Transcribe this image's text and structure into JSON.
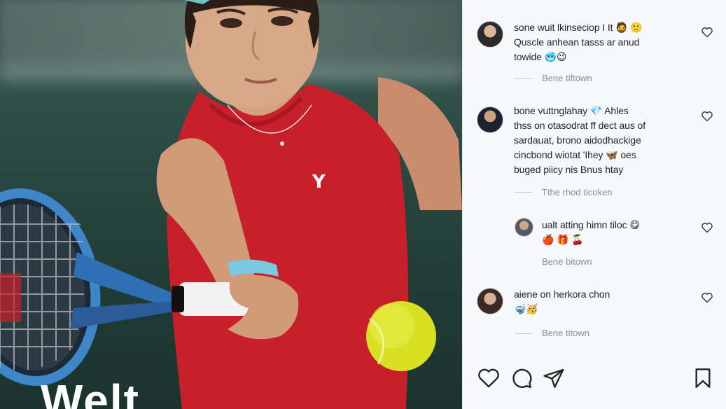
{
  "photo": {
    "overlay_text": "Welt",
    "brand_colors": {
      "jersey": "#c8202a",
      "court": "#203c35",
      "ball": "#d9e021"
    }
  },
  "comments": [
    {
      "text": "sone wuit lkinseciop I It 🧔 🙂\nQuscle anhean tasss ar anud\ntowide 🥶😉",
      "reply_label": "Bene tiftown",
      "avatar": "avatar-woman"
    },
    {
      "text": "bone vuttnglahay 💎 Ahles\nthss on otasodrat ff dect aus of\nsardauat, brono aidodhackige\ncincbond wiotat 'Ihey 🦋 oes\nbuged piicy nis Bnus htay",
      "reply_label": "Tthe rhod ticoken",
      "avatar": "avatar-man"
    },
    {
      "text": "ualt atting himn tiloc 😋\n🍎 🎁 🍒",
      "reply_label": "Bene bitown",
      "avatar": "avatar-man-reply"
    },
    {
      "text": "aiene on herkora chon\n🤿🥳",
      "reply_label": "Bene titown",
      "avatar": "avatar-woman-2"
    }
  ],
  "icons": {
    "like": "heart-icon",
    "comment": "comment-icon",
    "share": "share-icon",
    "save": "bookmark-icon"
  },
  "colors": {
    "panel_bg": "#f7f8f9",
    "text": "#262626",
    "muted": "#8e8e8e"
  }
}
